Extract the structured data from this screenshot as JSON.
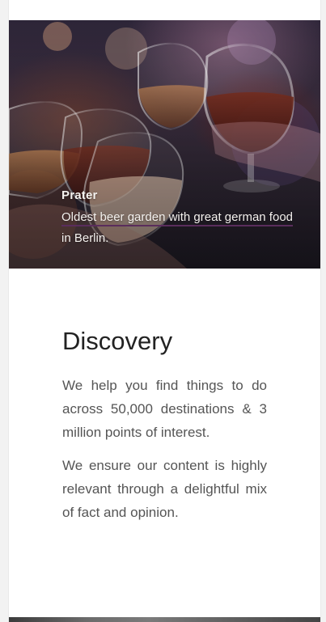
{
  "hero": {
    "title": "Prater",
    "description_link": "Oldest beer garden with great german food",
    "description_rest": " in Berlin.",
    "image_icon": "beer-toast-photo"
  },
  "discovery": {
    "heading": "Discovery",
    "paragraphs": [
      "We help you find things to do across 50,000 destinations & 3 million points of interest.",
      "We ensure our content is highly relevant through a delightful mix of fact and opinion."
    ]
  },
  "colors": {
    "page_bg": "#ffffff",
    "outer_bg": "#f2f2f2",
    "hero_text": "#f4f1ee",
    "link_underline": "#5a2d5c",
    "heading": "#222222",
    "body_text": "#555555"
  }
}
